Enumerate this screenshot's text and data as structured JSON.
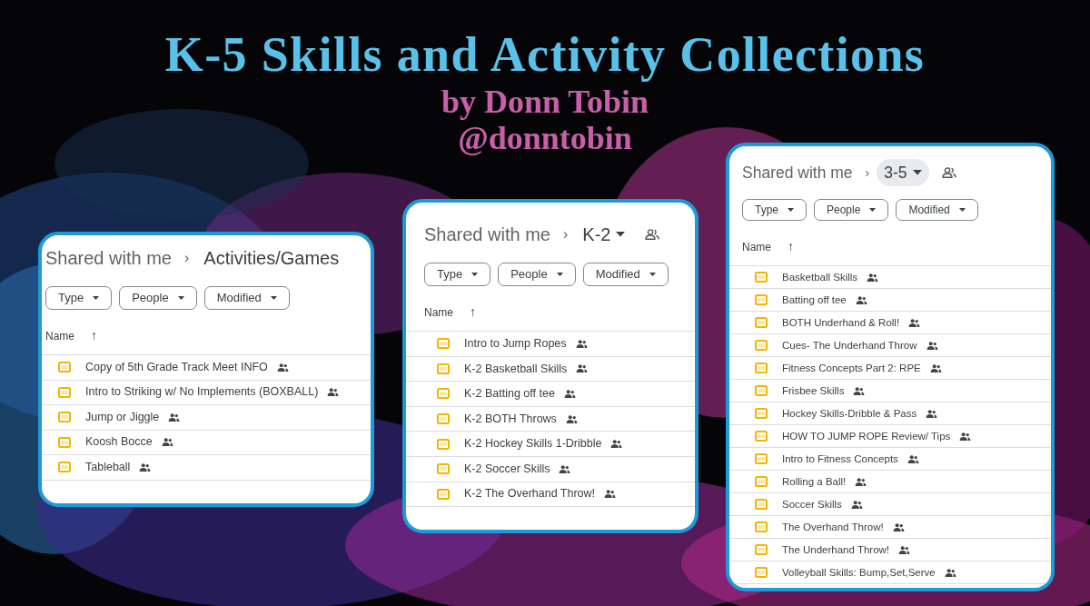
{
  "title": "K-5 Skills and Activity Collections",
  "byline": "by Donn Tobin",
  "handle": "@donntobin",
  "panels": [
    {
      "root": "Shared with me",
      "separator": "›",
      "folder": "Activities/Games",
      "selected": false,
      "dropdown": false,
      "shared": false,
      "filters": [
        "Type",
        "People",
        "Modified"
      ],
      "column": "Name",
      "sort": "↑",
      "files": [
        {
          "name": "Copy of 5th Grade Track Meet INFO",
          "shared": true
        },
        {
          "name": "Intro to Striking w/ No Implements (BOXBALL)",
          "shared": true
        },
        {
          "name": "Jump or Jiggle",
          "shared": true
        },
        {
          "name": "Koosh Bocce",
          "shared": true
        },
        {
          "name": "Tableball",
          "shared": true
        }
      ]
    },
    {
      "root": "Shared with me",
      "separator": "›",
      "folder": "K-2",
      "selected": false,
      "dropdown": true,
      "shared": true,
      "filters": [
        "Type",
        "People",
        "Modified"
      ],
      "column": "Name",
      "sort": "↑",
      "files": [
        {
          "name": "Intro to Jump Ropes",
          "shared": true
        },
        {
          "name": "K-2 Basketball Skills",
          "shared": true
        },
        {
          "name": "K-2 Batting off tee",
          "shared": true
        },
        {
          "name": "K-2 BOTH Throws",
          "shared": true
        },
        {
          "name": "K-2 Hockey Skills 1-Dribble",
          "shared": true
        },
        {
          "name": "K-2 Soccer Skills",
          "shared": true
        },
        {
          "name": "K-2 The Overhand Throw!",
          "shared": true
        }
      ]
    },
    {
      "root": "Shared with me",
      "separator": "›",
      "folder": "3-5",
      "selected": true,
      "dropdown": true,
      "shared": true,
      "filters": [
        "Type",
        "People",
        "Modified"
      ],
      "column": "Name",
      "sort": "↑",
      "files": [
        {
          "name": "Basketball Skills",
          "shared": true
        },
        {
          "name": "Batting off tee",
          "shared": true
        },
        {
          "name": "BOTH Underhand & Roll!",
          "shared": true
        },
        {
          "name": "Cues- The Underhand Throw",
          "shared": true
        },
        {
          "name": "Fitness Concepts Part 2: RPE",
          "shared": true
        },
        {
          "name": "Frisbee Skills",
          "shared": true
        },
        {
          "name": "Hockey Skills-Dribble & Pass",
          "shared": true
        },
        {
          "name": "HOW TO JUMP ROPE Review/ Tips",
          "shared": true
        },
        {
          "name": "Intro to Fitness Concepts",
          "shared": true
        },
        {
          "name": "Rolling a Ball!",
          "shared": true
        },
        {
          "name": "Soccer Skills",
          "shared": true
        },
        {
          "name": "The Overhand Throw!",
          "shared": true
        },
        {
          "name": "The Underhand Throw!",
          "shared": true
        },
        {
          "name": "Volleyball Skills: Bump,Set,Serve",
          "shared": true
        }
      ]
    }
  ]
}
